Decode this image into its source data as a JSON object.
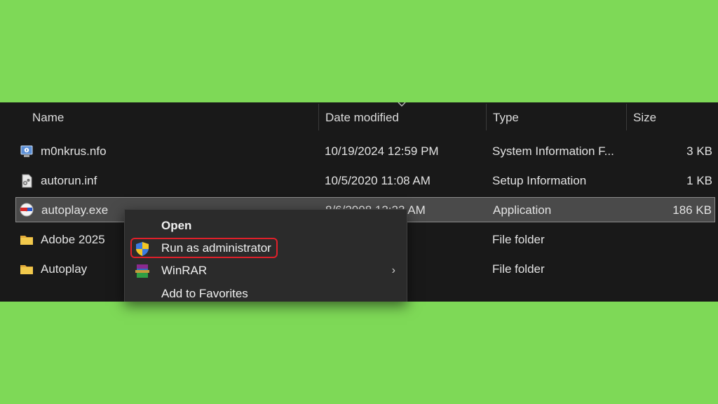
{
  "columns": {
    "name": "Name",
    "date_modified": "Date modified",
    "type": "Type",
    "size": "Size"
  },
  "files": [
    {
      "name": "m0nkrus.nfo",
      "date": "10/19/2024 12:59 PM",
      "type": "System Information F...",
      "size": "3 KB",
      "icon": "system-info-icon"
    },
    {
      "name": "autorun.inf",
      "date": "10/5/2020 11:08 AM",
      "type": "Setup Information",
      "size": "1 KB",
      "icon": "setup-info-icon"
    },
    {
      "name": "autoplay.exe",
      "date": "8/6/2008 12:23 AM",
      "type": "Application",
      "size": "186 KB",
      "icon": "application-icon",
      "selected": true
    },
    {
      "name": "Adobe 2025",
      "date": ":43 PM",
      "type": "File folder",
      "size": "",
      "icon": "folder-icon"
    },
    {
      "name": "Autoplay",
      "date": ":22 PM",
      "type": "File folder",
      "size": "",
      "icon": "folder-icon"
    }
  ],
  "context_menu": {
    "items": [
      {
        "label": "Open",
        "bold": true,
        "icon": ""
      },
      {
        "label": "Run as administrator",
        "icon": "uac-shield-icon",
        "highlighted": true
      },
      {
        "label": "WinRAR",
        "icon": "winrar-icon",
        "submenu": true
      },
      {
        "label": "Add to Favorites",
        "icon": ""
      }
    ],
    "submenu_arrow": "›"
  },
  "colors": {
    "background": "#7ed957",
    "explorer_bg": "#191919",
    "highlight_border": "#e0202a",
    "folder": "#f2c94c"
  }
}
